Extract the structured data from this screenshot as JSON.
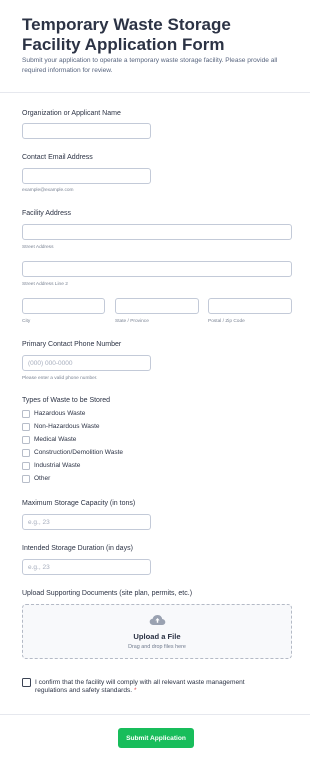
{
  "header": {
    "title": "Temporary Waste Storage Facility Application Form",
    "subtitle": "Submit your application to operate a temporary waste storage facility. Please provide all required information for review."
  },
  "organization": {
    "label": "Organization or Applicant Name",
    "value": ""
  },
  "email": {
    "label": "Contact Email Address",
    "value": "",
    "sublabel": "example@example.com"
  },
  "address": {
    "label": "Facility Address",
    "street_sublabel": "Street Address",
    "street2_sublabel": "Street Address Line 2",
    "city_sublabel": "City",
    "state_sublabel": "State / Province",
    "postal_sublabel": "Postal / Zip Code"
  },
  "phone": {
    "label": "Primary Contact Phone Number",
    "placeholder": "(000) 000-0000",
    "sublabel": "Please enter a valid phone number."
  },
  "waste_types": {
    "label": "Types of Waste to be Stored",
    "options": [
      "Hazardous Waste",
      "Non-Hazardous Waste",
      "Medical Waste",
      "Construction/Demolition Waste",
      "Industrial Waste",
      "Other"
    ]
  },
  "capacity": {
    "label": "Maximum Storage Capacity (in tons)",
    "placeholder": "e.g., 23"
  },
  "duration": {
    "label": "Intended Storage Duration (in days)",
    "placeholder": "e.g., 23"
  },
  "upload": {
    "label": "Upload Supporting Documents (site plan, permits, etc.)",
    "title": "Upload a File",
    "subtitle": "Drag and drop files here",
    "icon": "cloud-upload-icon"
  },
  "confirm": {
    "text": "I confirm that the facility will comply with all relevant waste management regulations and safety standards.",
    "required_mark": "*"
  },
  "submit": {
    "label": "Submit Application"
  },
  "colors": {
    "accent": "#18bd5b",
    "required": "#e5484d",
    "text": "#2c3345"
  }
}
